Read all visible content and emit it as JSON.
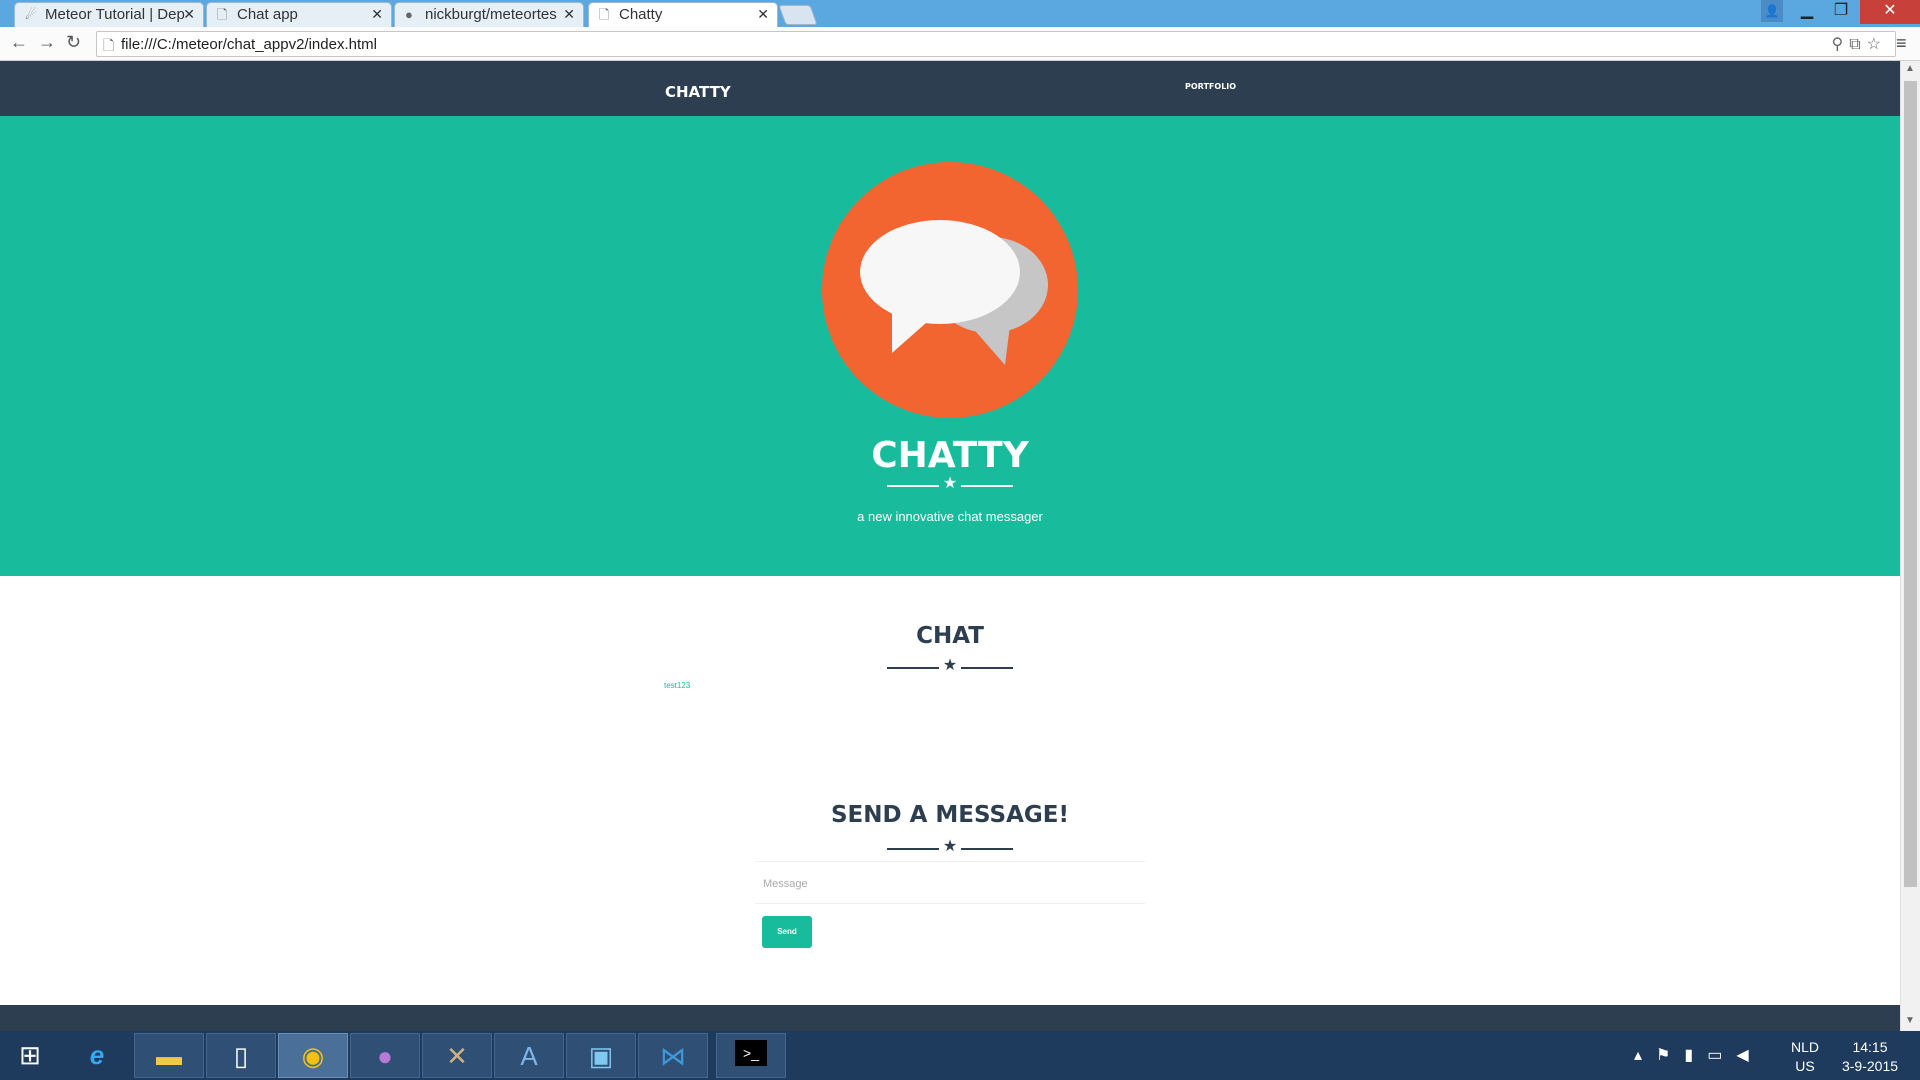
{
  "browser": {
    "tabs": [
      {
        "label": "Meteor Tutorial | Dep",
        "icon": "meteor-icon"
      },
      {
        "label": "Chat app",
        "icon": "page-icon"
      },
      {
        "label": "nickburgt/meteortes",
        "icon": "github-icon"
      },
      {
        "label": "Chatty",
        "icon": "page-icon",
        "active": true
      }
    ],
    "url": "file:///C:/meteor/chat_appv2/index.html"
  },
  "site": {
    "brand": "CHATTY",
    "nav_link": "PORTFOLIO",
    "hero_title": "CHATTY",
    "hero_subtitle": "a new innovative chat messager",
    "chat_title": "CHAT",
    "messages": [
      "test123"
    ],
    "send_title": "SEND A MESSAGE!",
    "message_placeholder": "Message",
    "send_label": "Send"
  },
  "colors": {
    "accent": "#18bc9c",
    "navy": "#2c3e50",
    "logo_orange": "#f26430"
  },
  "taskbar": {
    "apps": [
      "start-icon",
      "internet-explorer-icon",
      "file-explorer-icon",
      "notepad-icon",
      "chrome-icon",
      "github-icon",
      "tools-icon",
      "text-editor-icon",
      "photo-viewer-icon",
      "visual-studio-code-icon",
      "command-prompt-icon"
    ],
    "lang_top": "NLD",
    "lang_bottom": "US",
    "time": "14:15",
    "date": "3-9-2015"
  }
}
